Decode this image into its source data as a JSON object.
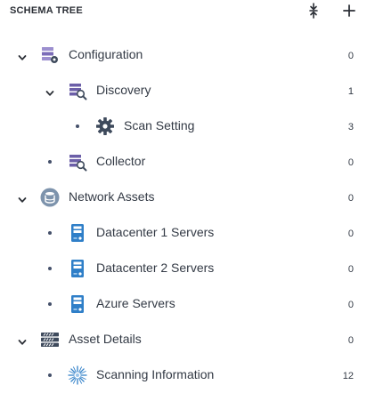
{
  "panel": {
    "title": "SCHEMA TREE",
    "collapse_icon": "collapse-all-icon",
    "add_icon": "plus-icon"
  },
  "tree": [
    {
      "label": "Configuration",
      "count": "0",
      "icon": "config-icon",
      "level": 0,
      "expanded": true
    },
    {
      "label": "Discovery",
      "count": "1",
      "icon": "discovery-icon",
      "level": 1,
      "expanded": true
    },
    {
      "label": "Scan Setting",
      "count": "3",
      "icon": "gear-icon",
      "level": 2,
      "expanded": false
    },
    {
      "label": "Collector",
      "count": "0",
      "icon": "collector-icon",
      "level": 1,
      "expanded": false
    },
    {
      "label": "Network Assets",
      "count": "0",
      "icon": "database-icon",
      "level": 0,
      "expanded": true
    },
    {
      "label": "Datacenter 1 Servers",
      "count": "0",
      "icon": "server-icon",
      "level": 1,
      "expanded": false
    },
    {
      "label": "Datacenter 2 Servers",
      "count": "0",
      "icon": "server-icon",
      "level": 1,
      "expanded": false
    },
    {
      "label": "Azure Servers",
      "count": "0",
      "icon": "server-icon",
      "level": 1,
      "expanded": false
    },
    {
      "label": "Asset Details",
      "count": "0",
      "icon": "rack-icon",
      "level": 0,
      "expanded": true
    },
    {
      "label": "Scanning Information",
      "count": "12",
      "icon": "scan-burst-icon",
      "level": 1,
      "expanded": false
    }
  ],
  "colors": {
    "text": "#333a45",
    "icon_blue": "#2f7fc8",
    "icon_purple": "#6c5fa8",
    "icon_dark": "#3e4a5c"
  }
}
